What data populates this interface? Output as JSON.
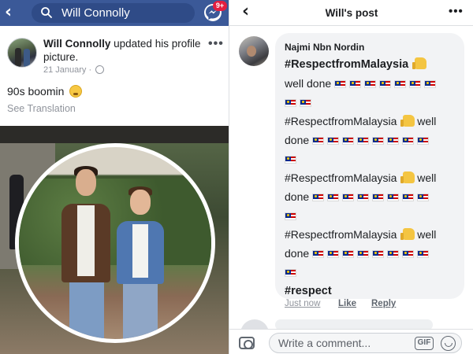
{
  "left": {
    "search": {
      "query": "Will Connolly"
    },
    "messenger": {
      "badge": "9+"
    },
    "post": {
      "author": "Will Connolly",
      "action": "updated his profile picture.",
      "date": "21 January",
      "date_separator": "·",
      "text": "90s boomin",
      "see_translation": "See Translation"
    }
  },
  "right": {
    "header": {
      "title": "Will's post"
    },
    "comment": {
      "author": "Najmi Nbn Nordin",
      "lines": [
        {
          "text": "#RespectfromMalaysia",
          "thumb": true,
          "flags": 0,
          "bold": true
        },
        {
          "text": "well done",
          "thumb": false,
          "flags": 7,
          "bold": false
        },
        {
          "text": "",
          "thumb": false,
          "flags": 2,
          "bold": false
        },
        {
          "text": "#RespectfromMalaysia",
          "thumb": true,
          "after": "well",
          "flags": 0,
          "bold": false
        },
        {
          "text": "done",
          "thumb": false,
          "flags": 8,
          "bold": false
        },
        {
          "text": "",
          "thumb": false,
          "flags": 1,
          "bold": false
        },
        {
          "text": "#RespectfromMalaysia",
          "thumb": true,
          "after": "well",
          "flags": 0,
          "bold": false
        },
        {
          "text": "done",
          "thumb": false,
          "flags": 8,
          "bold": false
        },
        {
          "text": "",
          "thumb": false,
          "flags": 1,
          "bold": false
        },
        {
          "text": "#RespectfromMalaysia",
          "thumb": true,
          "after": "well",
          "flags": 0,
          "bold": false
        },
        {
          "text": "done",
          "thumb": false,
          "flags": 8,
          "bold": false
        },
        {
          "text": "",
          "thumb": false,
          "flags": 1,
          "bold": false
        },
        {
          "text": "#respect",
          "thumb": false,
          "flags": 0,
          "bold": true
        }
      ],
      "time": "Just now",
      "like": "Like",
      "reply": "Reply"
    },
    "composer": {
      "placeholder": "Write a comment...",
      "gif": "GIF"
    }
  },
  "colors": {
    "facebook_blue": "#3b5998",
    "badge_red": "#e41e3f",
    "bubble_gray": "#f2f3f5",
    "meta_gray": "#90949c"
  },
  "icons": [
    "back-arrow-icon",
    "search-icon",
    "messenger-icon",
    "globe-icon",
    "more-icon",
    "grimace-emoji-icon",
    "thumbs-up-emoji-icon",
    "malaysia-flag-emoji-icon",
    "camera-icon",
    "gif-icon",
    "smiley-icon"
  ]
}
